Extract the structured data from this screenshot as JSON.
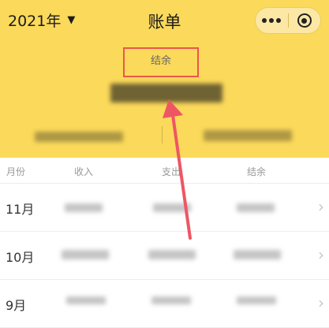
{
  "header": {
    "year_label": "2021年",
    "title": "账单",
    "balance_label": "结余"
  },
  "table": {
    "columns": [
      "月份",
      "收入",
      "支出",
      "结余"
    ],
    "rows": [
      {
        "month": "11月"
      },
      {
        "month": "10月"
      },
      {
        "month": "9月"
      }
    ]
  },
  "icons": {
    "year_caret": "caret-down-icon",
    "more": "more-dots-icon",
    "close": "target-circle-icon",
    "row_chevron": "chevron-right-icon"
  },
  "colors": {
    "header_bg": "#fbd95a",
    "highlight_box": "#e9574c",
    "annotation_arrow": "#ee5663"
  }
}
